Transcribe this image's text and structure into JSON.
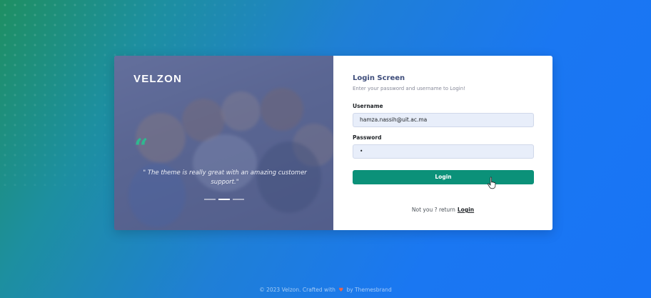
{
  "brand": {
    "logo_text": "VELZON"
  },
  "carousel": {
    "quote_icon": "quote-icon",
    "quote_text": "\" The theme is really great with an amazing customer support.\"",
    "slides": 3,
    "active_slide": 2
  },
  "login": {
    "title": "Login Screen",
    "subtitle": "Enter your password and username to Login!",
    "username_label": "Username",
    "username_value": "hamza.nassih@uit.ac.ma",
    "password_label": "Password",
    "password_value": "•",
    "button_label": "Login",
    "not_you_text": "Not you ? return",
    "return_link": "Login"
  },
  "footer": {
    "copyright_prefix": "© 2023 Velzon. Crafted with",
    "copyright_suffix": "by Themesbrand",
    "heart_icon": "heart-icon"
  },
  "colors": {
    "primary_button": "#0b9179",
    "quote_accent": "#2fb890",
    "title": "#3d4c7a",
    "heart": "#f06548"
  }
}
